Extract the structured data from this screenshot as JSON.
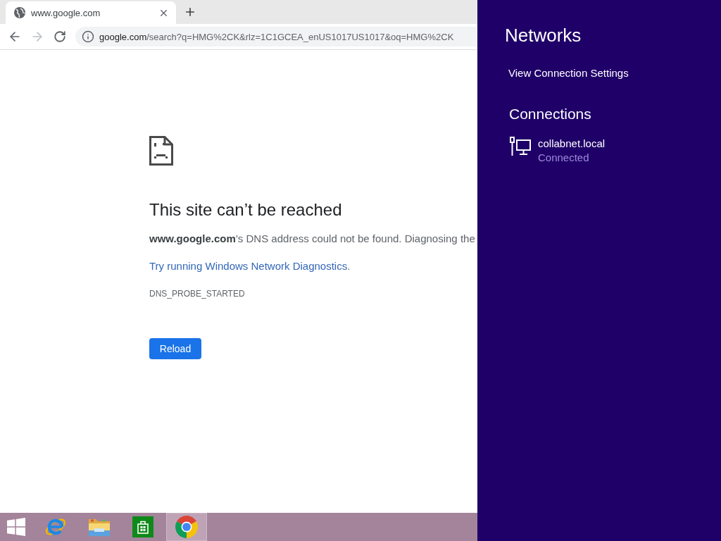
{
  "browser": {
    "tabs": [
      {
        "title": "www.google.com",
        "selected": true
      }
    ],
    "nav_buttons": [
      {
        "kind": "back",
        "disabled": false
      },
      {
        "kind": "forward",
        "disabled": true
      },
      {
        "kind": "reload",
        "disabled": false
      }
    ],
    "address_bar": {
      "host": "google.com",
      "path": "/search?q=HMG%2CK&rlz=1C1GCEA_enUS1017US1017&oq=HMG%2CK"
    },
    "error_page": {
      "title": "This site can’t be reached",
      "message": "**www.google.com**’s DNS address could not be found. Diagnosing the",
      "suggestion_link": "Try running Windows Network Diagnostics",
      "suggestion_end": ".",
      "error_code": "DNS_PROBE_STARTED",
      "reload_button": "Reload"
    }
  },
  "taskbar": {
    "items": [
      {
        "kind": "start",
        "selected": false
      },
      {
        "kind": "internet-explorer",
        "selected": false
      },
      {
        "kind": "file-explorer",
        "selected": false
      },
      {
        "kind": "store",
        "selected": false
      },
      {
        "kind": "chrome",
        "selected": true
      }
    ]
  },
  "networks_panel": {
    "title": "Networks",
    "settings_link": "View Connection Settings",
    "section_title": "Connections",
    "connections": [
      {
        "name": "collabnet.local",
        "status": "Connected"
      }
    ]
  }
}
